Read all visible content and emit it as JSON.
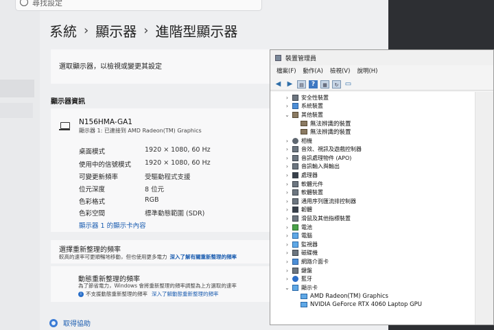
{
  "settings": {
    "search_placeholder": "尋找設定",
    "breadcrumb": [
      "系統",
      "顯示器",
      "進階型顯示器"
    ],
    "select_display_label": "選取顯示器，以檢視或變更其設定",
    "info_section_title": "顯示器資訊",
    "monitor_name": "N156HMA-GA1",
    "monitor_sub": "顯示器 1: 已連接到 AMD Radeon(TM) Graphics",
    "specs": [
      {
        "label": "桌面模式",
        "value": "1920 × 1080, 60 Hz"
      },
      {
        "label": "使用中的信號模式",
        "value": "1920 × 1080, 60 Hz"
      },
      {
        "label": "可變更新頻率",
        "value": "受驅動程式支援"
      },
      {
        "label": "位元深度",
        "value": "8 位元"
      },
      {
        "label": "色彩格式",
        "value": "RGB"
      },
      {
        "label": "色彩空間",
        "value": "標準動態範圍 (SDR)"
      }
    ],
    "adapter_link": "顯示器 1 的顯示卡內容",
    "refresh_title": "選擇重新整理的頻率",
    "refresh_desc": "較高的速率可更順暢地移動，但也使用更多電力",
    "refresh_link": "深入了解有關重新整理的頻率",
    "dynamic_title": "動態重新整理的頻率",
    "dynamic_desc": "為了節省電力，Windows 會將重新整理的頻率調整為上方選取的速率",
    "dynamic_info": "不支援動態重新整理的頻率",
    "dynamic_link": "深入了解動態重新整理的頻率",
    "help": "取得協助"
  },
  "device_manager": {
    "title": "裝置管理員",
    "menu": [
      "檔案(F)",
      "動作(A)",
      "檢視(V)",
      "說明(H)"
    ],
    "toolbar_icons": [
      "back-icon",
      "forward-icon",
      "properties-icon",
      "help-icon",
      "view-icon",
      "update-icon",
      "monitor-icon"
    ],
    "tree": [
      {
        "label": "安全性裝置",
        "expanded": false,
        "icon": "security-icon"
      },
      {
        "label": "系統裝置",
        "expanded": false,
        "icon": "system-icon"
      },
      {
        "label": "其他裝置",
        "expanded": true,
        "icon": "other-devices-icon"
      },
      {
        "label": "無法辨識的裝置",
        "child": true,
        "icon": "warning-device-icon"
      },
      {
        "label": "無法辨識的裝置",
        "child": true,
        "icon": "warning-device-icon"
      },
      {
        "label": "相機",
        "expanded": false,
        "icon": "camera-icon"
      },
      {
        "label": "音效、視訊及遊戲控制器",
        "expanded": false,
        "icon": "audio-icon"
      },
      {
        "label": "音訊處理物件 (APO)",
        "expanded": false,
        "icon": "audio-icon"
      },
      {
        "label": "音訊輸入與輸出",
        "expanded": false,
        "icon": "audio-icon"
      },
      {
        "label": "處理器",
        "expanded": false,
        "icon": "processor-icon"
      },
      {
        "label": "軟體元件",
        "expanded": false,
        "icon": "software-component-icon"
      },
      {
        "label": "軟體裝置",
        "expanded": false,
        "icon": "software-device-icon"
      },
      {
        "label": "通用序列匯流排控制器",
        "expanded": false,
        "icon": "usb-icon"
      },
      {
        "label": "韌體",
        "expanded": false,
        "icon": "firmware-icon"
      },
      {
        "label": "滑鼠及其他指標裝置",
        "expanded": false,
        "icon": "mouse-icon"
      },
      {
        "label": "電池",
        "expanded": false,
        "icon": "battery-icon"
      },
      {
        "label": "電腦",
        "expanded": false,
        "icon": "computer-icon"
      },
      {
        "label": "監視器",
        "expanded": false,
        "icon": "monitor-icon"
      },
      {
        "label": "磁碟機",
        "expanded": false,
        "icon": "disk-icon"
      },
      {
        "label": "網路介面卡",
        "expanded": false,
        "icon": "network-icon"
      },
      {
        "label": "鍵盤",
        "expanded": false,
        "icon": "keyboard-icon"
      },
      {
        "label": "藍牙",
        "expanded": false,
        "icon": "bluetooth-icon"
      },
      {
        "label": "顯示卡",
        "expanded": true,
        "icon": "display-adapter-icon"
      },
      {
        "label": "AMD Radeon(TM) Graphics",
        "child": true,
        "icon": "display-adapter-icon"
      },
      {
        "label": "NVIDIA GeForce RTX 4060 Laptop GPU",
        "child": true,
        "icon": "display-adapter-icon"
      }
    ]
  }
}
